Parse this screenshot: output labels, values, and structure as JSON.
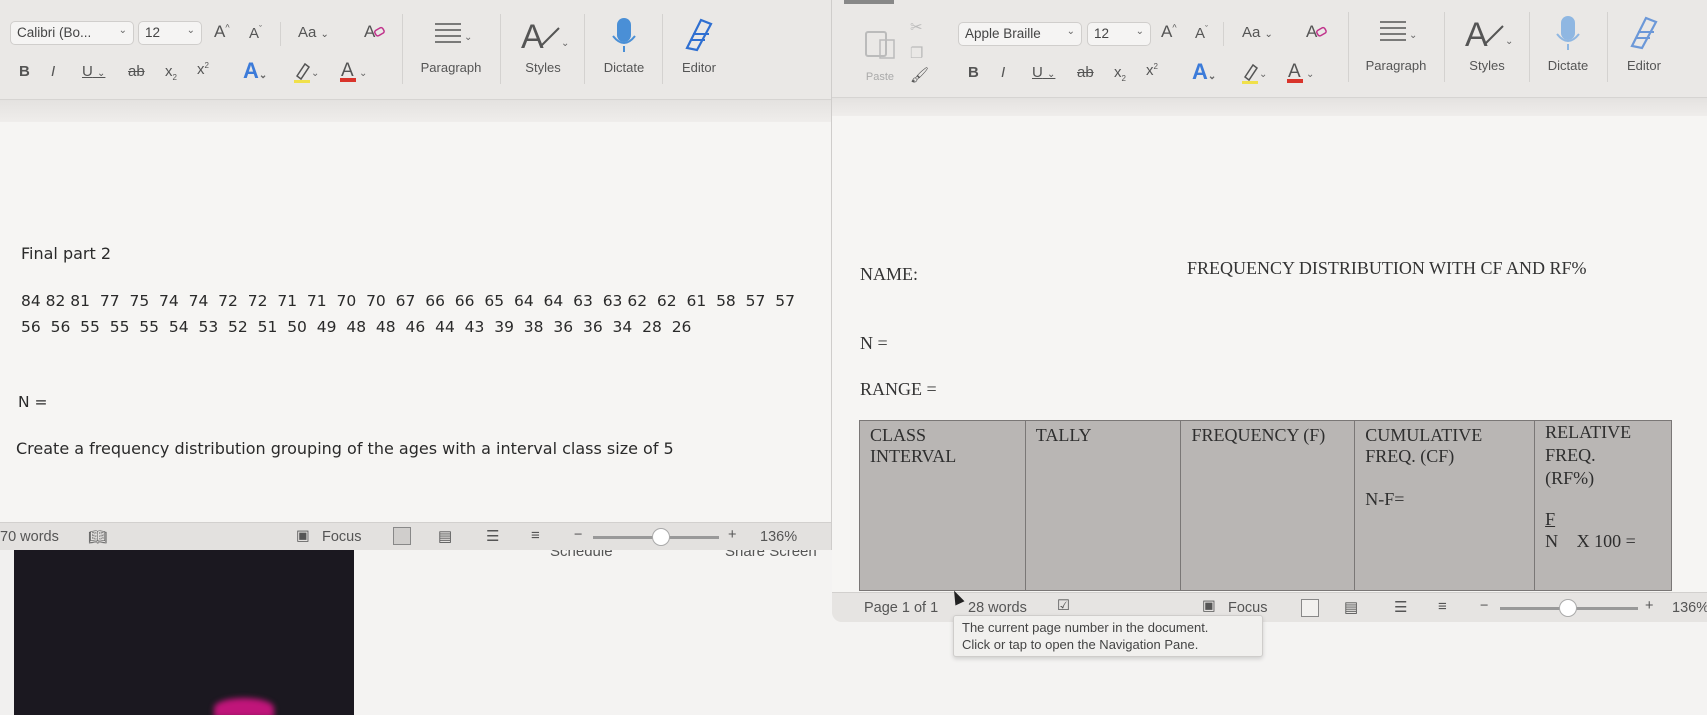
{
  "left_window": {
    "toolbar": {
      "font_name": "Calibri (Bo...",
      "font_size": "12",
      "grow_font": "A",
      "shrink_font": "A",
      "change_case": "Aa",
      "bold": "B",
      "italic": "I",
      "underline": "U",
      "strike": "ab",
      "subscript": "x",
      "superscript": "x",
      "paragraph_label": "Paragraph",
      "styles_label": "Styles",
      "dictate_label": "Dictate",
      "editor_label": "Editor"
    },
    "document": {
      "heading": "Final part 2",
      "numbers_line1": "84 82 81  77  75  74  74  72  72  71  71  70  70  67  66  66  65  64  64  63  63 62  62  61  58  57  57",
      "numbers_line2": "56  56  55  55  55  54  53  52  51  50  49  48  48  46  44  43  39  38  36  36  34  28  26",
      "n_label": "N =",
      "instruction": "Create a frequency distribution grouping of the ages with a interval class size of 5"
    },
    "status": {
      "word_count": "70 words",
      "focus": "Focus",
      "zoom_minus": "−",
      "zoom_plus": "+",
      "zoom": "136%"
    }
  },
  "right_window": {
    "toolbar": {
      "paste_label": "Paste",
      "font_name": "Apple Braille",
      "font_size": "12",
      "grow_font": "A",
      "shrink_font": "A",
      "change_case": "Aa",
      "bold": "B",
      "italic": "I",
      "underline": "U",
      "strike": "ab",
      "subscript": "x",
      "superscript": "x",
      "paragraph_label": "Paragraph",
      "styles_label": "Styles",
      "dictate_label": "Dictate",
      "editor_label": "Editor"
    },
    "document": {
      "name_label": "NAME:",
      "title": "FREQUENCY DISTRIBUTION WITH CF AND RF%",
      "n_label": "N =",
      "range_label": "RANGE =",
      "table": {
        "headers": [
          "CLASS\nINTERVAL",
          "TALLY",
          "FREQUENCY (F)",
          "CUMULATIVE\nFREQ. (CF)",
          "RELATIVE\nFREQ.\n(RF%)"
        ],
        "cf_note": "N-F=",
        "rf_fraction_top": "F",
        "rf_fraction_bottom": "N",
        "rf_formula": "X 100 ="
      }
    },
    "status": {
      "page": "Page 1 of 1",
      "word_count": "28 words",
      "focus": "Focus",
      "zoom_minus": "−",
      "zoom_plus": "+",
      "zoom": "136%"
    },
    "tooltip": {
      "line1": "The current page number in the document.",
      "line2": "Click or tap to open the Navigation Pane."
    }
  },
  "background": {
    "schedule_label": "Schedule",
    "share_screen_label": "Share Screen"
  },
  "colors": {
    "table_fill": "#b9b6b4",
    "dictate_blue": "#4a8fd6",
    "editor_blue": "#2f6fd1",
    "font_color_red": "#d9342b",
    "highlight_yellow": "#f0e04a",
    "text_effects_blue": "#3c7bd9"
  }
}
